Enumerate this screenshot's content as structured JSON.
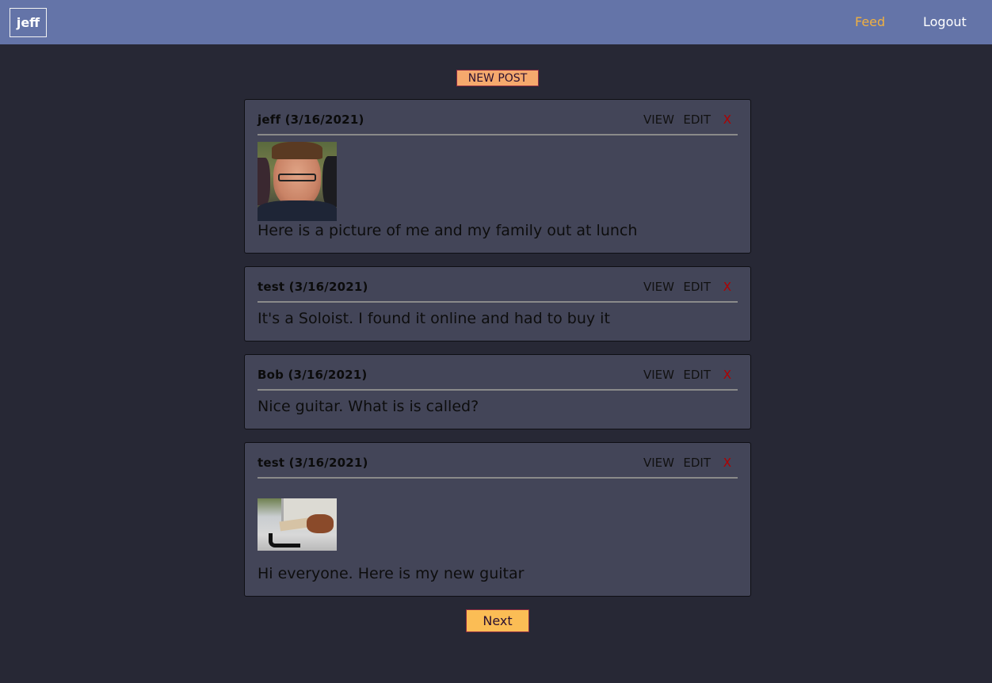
{
  "nav": {
    "brand": "jeff",
    "feed": "Feed",
    "logout": "Logout"
  },
  "new_post_label": "NEW POST",
  "posts": [
    {
      "author": "jeff (3/16/2021)",
      "view": "VIEW",
      "edit": "EDIT",
      "delete": "X",
      "text": "Here is a picture of me and my family out at lunch"
    },
    {
      "author": "test (3/16/2021)",
      "view": "VIEW",
      "edit": "EDIT",
      "delete": "X",
      "text": "It's a Soloist. I found it online and had to buy it"
    },
    {
      "author": "Bob (3/16/2021)",
      "view": "VIEW",
      "edit": "EDIT",
      "delete": "X",
      "text": "Nice guitar. What is is called?"
    },
    {
      "author": "test (3/16/2021)",
      "view": "VIEW",
      "edit": "EDIT",
      "delete": "X",
      "text": "Hi everyone. Here is my new guitar"
    }
  ],
  "next_label": "Next",
  "colors": {
    "navbar": "#6474a8",
    "background": "#272835",
    "card": "#434558",
    "feed_link": "#f0b040",
    "delete": "#b00000",
    "next_button": "#fbbd55",
    "new_post_button": "#f5a96d"
  }
}
